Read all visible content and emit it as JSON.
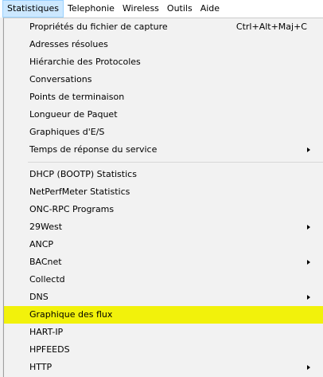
{
  "menubar": {
    "items": [
      "Statistiques",
      "Telephonie",
      "Wireless",
      "Outils",
      "Aide"
    ]
  },
  "menu": {
    "section1": [
      {
        "label": "Propriétés du fichier de capture",
        "shortcut": "Ctrl+Alt+Maj+C"
      },
      {
        "label": "Adresses résolues"
      },
      {
        "label": "Hiérarchie des Protocoles"
      },
      {
        "label": "Conversations"
      },
      {
        "label": "Points de terminaison"
      },
      {
        "label": "Longueur de Paquet"
      },
      {
        "label": "Graphiques d'E/S"
      },
      {
        "label": "Temps de réponse du service",
        "submenu": true
      }
    ],
    "section2": [
      {
        "label": "DHCP (BOOTP) Statistics"
      },
      {
        "label": "NetPerfMeter Statistics"
      },
      {
        "label": "ONC-RPC Programs"
      },
      {
        "label": "29West",
        "submenu": true
      },
      {
        "label": "ANCP"
      },
      {
        "label": "BACnet",
        "submenu": true
      },
      {
        "label": "Collectd"
      },
      {
        "label": "DNS",
        "submenu": true
      },
      {
        "label": "Graphique des flux",
        "highlighted": true
      },
      {
        "label": "HART-IP"
      },
      {
        "label": "HPFEEDS"
      },
      {
        "label": "HTTP",
        "submenu": true
      }
    ]
  },
  "colors": {
    "highlight": "#f2f20b",
    "active_menu": "#cce8ff"
  }
}
